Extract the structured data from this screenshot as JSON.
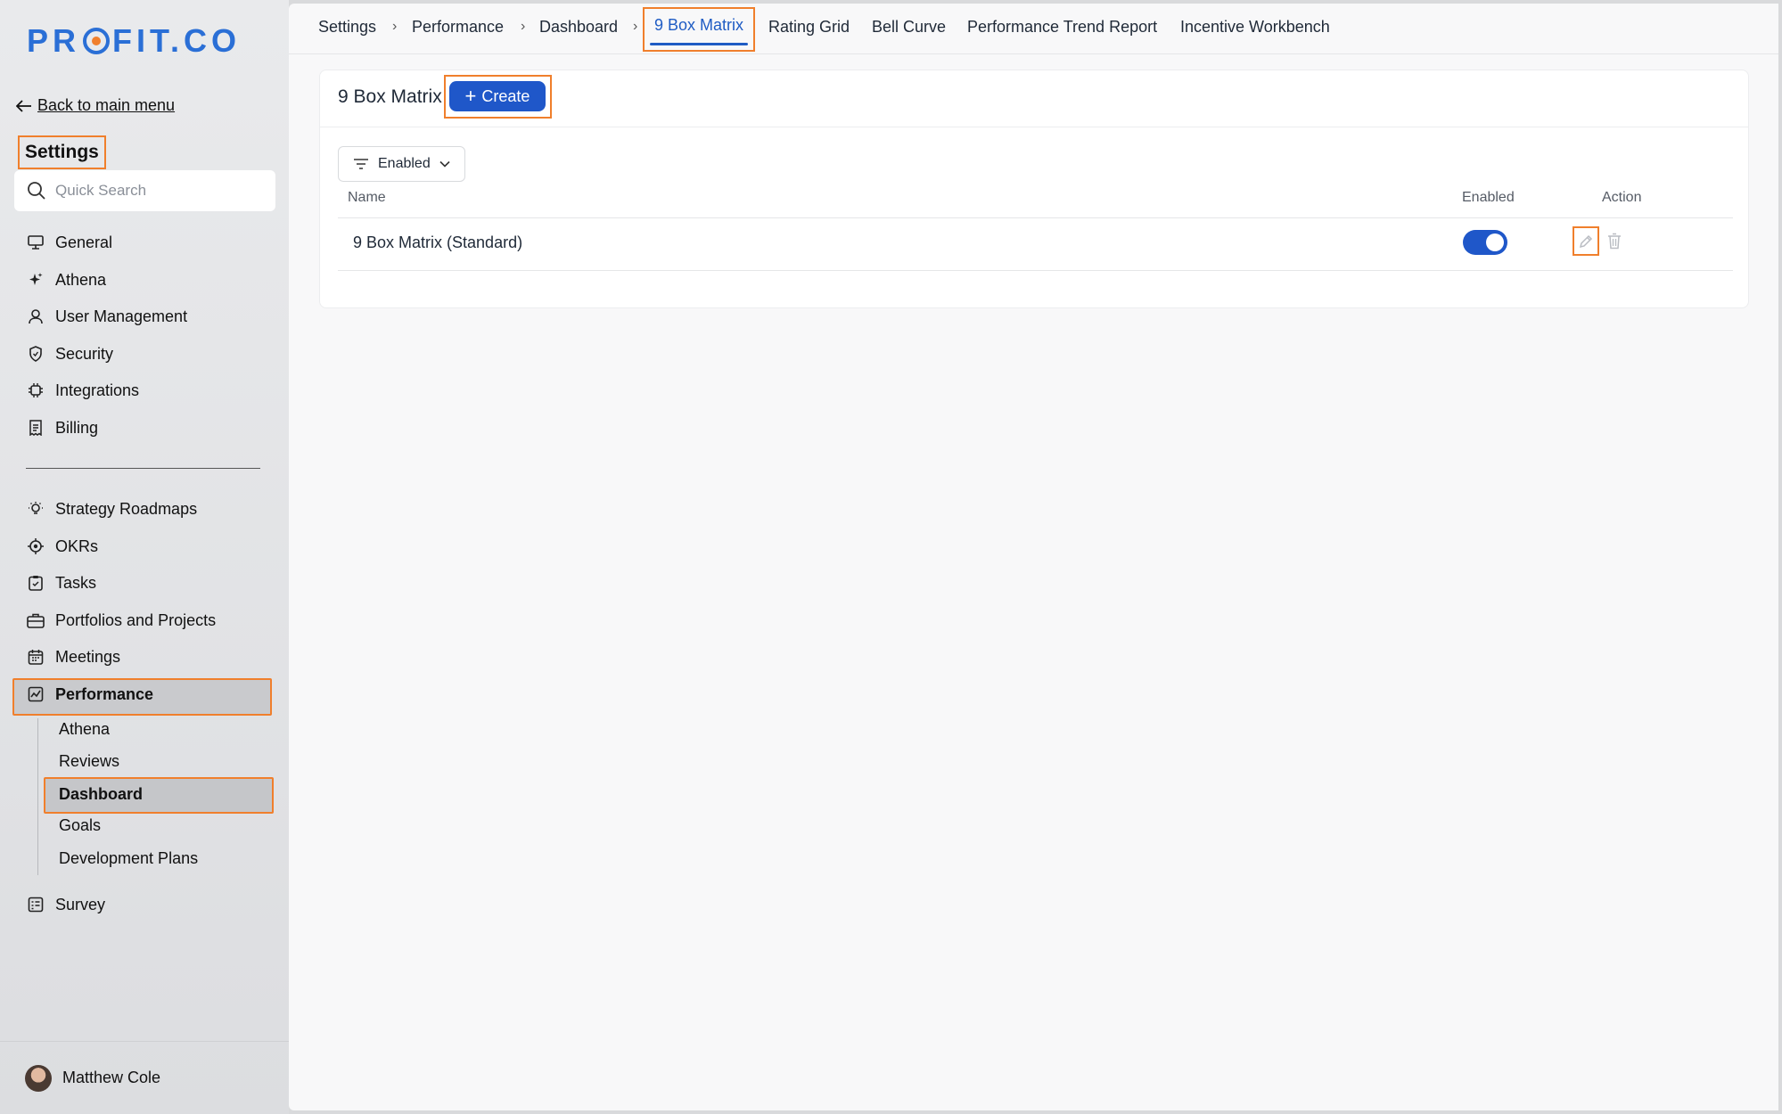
{
  "brand": {
    "logo_text": "PROFIT.CO"
  },
  "sidebar": {
    "back_label": "Back to main menu",
    "title": "Settings",
    "search_placeholder": "Quick Search",
    "items_top": [
      {
        "label": "General",
        "icon": "monitor-icon"
      },
      {
        "label": "Athena",
        "icon": "sparkle-icon"
      },
      {
        "label": "User Management",
        "icon": "user-icon"
      },
      {
        "label": "Security",
        "icon": "shield-icon"
      },
      {
        "label": "Integrations",
        "icon": "chip-icon"
      },
      {
        "label": "Billing",
        "icon": "receipt-icon"
      }
    ],
    "items_bottom": [
      {
        "label": "Strategy Roadmaps",
        "icon": "lightbulb-icon"
      },
      {
        "label": "OKRs",
        "icon": "target-icon"
      },
      {
        "label": "Tasks",
        "icon": "clipboard-check-icon"
      },
      {
        "label": "Portfolios and Projects",
        "icon": "briefcase-icon"
      },
      {
        "label": "Meetings",
        "icon": "calendar-icon"
      },
      {
        "label": "Performance",
        "icon": "chart-icon"
      }
    ],
    "performance_sub": [
      "Athena",
      "Reviews",
      "Dashboard",
      "Goals",
      "Development Plans"
    ],
    "survey": {
      "label": "Survey",
      "icon": "survey-icon"
    },
    "user_name": "Matthew Cole"
  },
  "topbar": {
    "breadcrumbs": [
      "Settings",
      "Performance",
      "Dashboard"
    ],
    "separator": "›",
    "tabs": [
      "9 Box Matrix",
      "Rating Grid",
      "Bell Curve",
      "Performance Trend Report",
      "Incentive Workbench"
    ],
    "active_tab": "9 Box Matrix"
  },
  "content": {
    "title": "9 Box Matrix",
    "create_label": "Create",
    "filter_label": "Enabled",
    "columns": {
      "name": "Name",
      "enabled": "Enabled",
      "action": "Action"
    },
    "rows": [
      {
        "name": "9 Box Matrix (Standard)",
        "enabled": true
      }
    ]
  },
  "colors": {
    "accent": "#1f57c9",
    "highlight": "#f07f2c",
    "logo": "#2a6fd6"
  }
}
